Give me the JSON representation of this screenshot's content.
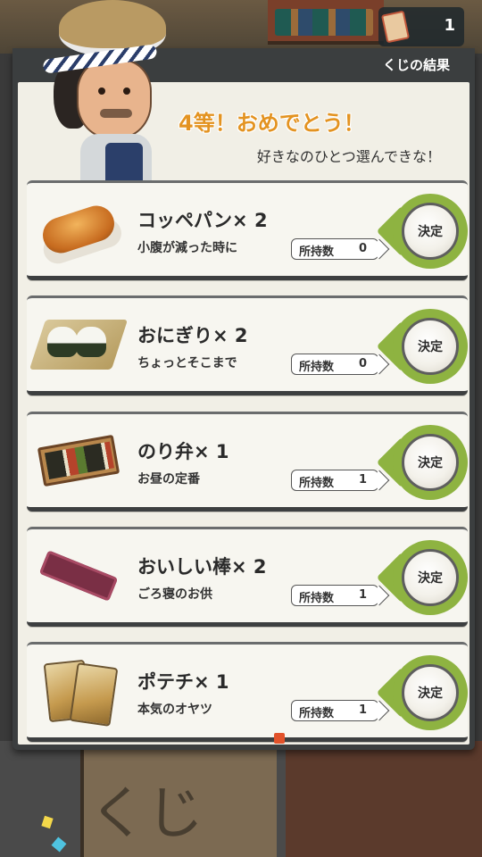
{
  "status_bar": {
    "ticket_count": "1"
  },
  "panel": {
    "title": "くじの結果",
    "result_heading": "4等！おめでとう！",
    "result_subtext": "好きなのひとつ選んできな！"
  },
  "background": {
    "board_text": "くじ"
  },
  "prizes": [
    {
      "name": "コッペパン× 2",
      "description": "小腹が減った時に",
      "owned_label": "所持数",
      "owned_count": "0",
      "decide_label": "決定",
      "icon": "bread-icon"
    },
    {
      "name": "おにぎり× 2",
      "description": "ちょっとそこまで",
      "owned_label": "所持数",
      "owned_count": "0",
      "decide_label": "決定",
      "icon": "onigiri-icon"
    },
    {
      "name": "のり弁× 1",
      "description": "お昼の定番",
      "owned_label": "所持数",
      "owned_count": "1",
      "decide_label": "決定",
      "icon": "bento-icon"
    },
    {
      "name": "おいしい棒× 2",
      "description": "ごろ寝のお供",
      "owned_label": "所持数",
      "owned_count": "1",
      "decide_label": "決定",
      "icon": "snack-stick-icon"
    },
    {
      "name": "ポテチ× 1",
      "description": "本気のオヤツ",
      "owned_label": "所持数",
      "owned_count": "1",
      "decide_label": "決定",
      "icon": "potato-chips-icon"
    }
  ],
  "colors": {
    "accent_green": "#8eb341",
    "heading_orange": "#e39321",
    "panel_dark": "#3b3e3f",
    "card_bg": "#f7f6f0"
  }
}
